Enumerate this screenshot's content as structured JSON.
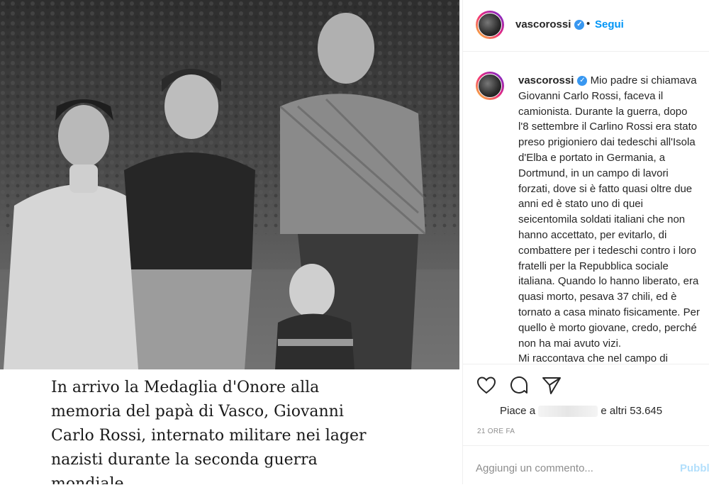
{
  "post": {
    "caption_lines": [
      "In arrivo la Medaglia d'Onore alla",
      "memoria del papà di Vasco, Giovanni",
      "Carlo Rossi, internato militare nei lager",
      "nazisti durante la seconda guerra",
      "mondiale."
    ]
  },
  "header": {
    "username": "vascorossi",
    "verified_icon": "verified-badge-icon",
    "separator": "•",
    "follow_label": "Segui"
  },
  "comment": {
    "username": "vascorossi",
    "lines": [
      "Mio padre si chiamava",
      "Giovanni Carlo Rossi, faceva il",
      "camionista. Durante la guerra, dopo",
      "l'8 settembre il Carlino Rossi era stato",
      "preso prigioniero dai tedeschi all'Isola",
      "d'Elba e portato in Germania, a",
      "Dortmund, in un campo di lavori",
      "forzati, dove si è fatto quasi oltre due",
      "anni ed è stato uno di quei",
      "seicentomila soldati italiani che non",
      "hanno accettato, per evitarlo, di",
      "combattere per i tedeschi contro i loro",
      "fratelli per la Repubblica sociale",
      "italiana. Quando lo hanno liberato, era",
      "quasi morto, pesava 37 chili, ed è",
      "tornato a casa minato fisicamente. Per",
      "quello è morto giovane, credo, perché",
      "non ha mai avuto vizi.",
      "Mi raccontava che nel campo di"
    ]
  },
  "actions": {
    "icons": [
      "heart-icon",
      "comment-bubble-icon",
      "paper-plane-icon"
    ],
    "likes_prefix": "Piace a",
    "likes_suffix": "e altri 53.645",
    "timestamp": "21 ORE FA"
  },
  "add_comment": {
    "placeholder": "Aggiungi un commento...",
    "publish_label": "Pubblica"
  },
  "colors": {
    "link": "#0095f6",
    "verified": "#3897f0",
    "muted": "#8e8e8e",
    "publish_disabled": "#b2dffc"
  }
}
